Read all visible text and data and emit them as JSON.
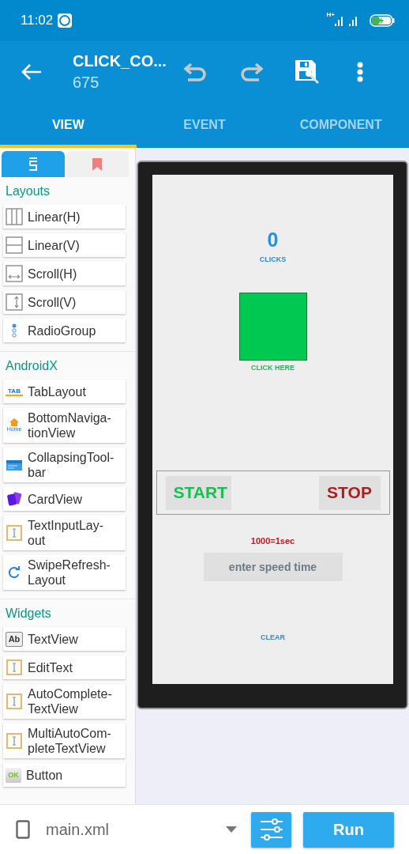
{
  "status_bar": {
    "time": "11:02",
    "network": "H+"
  },
  "app_bar": {
    "title": "CLICK_CO...",
    "subtitle": "675"
  },
  "tabs": [
    {
      "label": "VIEW",
      "selected": true
    },
    {
      "label": "EVENT",
      "selected": false
    },
    {
      "label": "COMPONENT",
      "selected": false
    }
  ],
  "palette": {
    "tabs": [
      {
        "kind": "widgets",
        "selected": true
      },
      {
        "kind": "bookmarks",
        "selected": false
      }
    ],
    "sections": [
      {
        "title": "Layouts",
        "items": [
          {
            "kind": "linear-h",
            "label": "Linear(H)"
          },
          {
            "kind": "linear-v",
            "label": "Linear(V)"
          },
          {
            "kind": "scroll-h",
            "label": "Scroll(H)"
          },
          {
            "kind": "scroll-v",
            "label": "Scroll(V)"
          },
          {
            "kind": "radio-group",
            "label": "RadioGroup"
          }
        ]
      },
      {
        "title": "AndroidX",
        "items": [
          {
            "kind": "tab-layout",
            "label": "TabLayout",
            "icon_text": "TAB"
          },
          {
            "kind": "bottom-nav",
            "label": "BottomNaviga-tionView",
            "icon_text": "Home"
          },
          {
            "kind": "collapsing-toolbar",
            "label": "CollapsingTool-bar"
          },
          {
            "kind": "card-view",
            "label": "CardView"
          },
          {
            "kind": "text-input",
            "label": "TextInputLay-out"
          },
          {
            "kind": "swipe-refresh",
            "label": "SwipeRefresh-Layout"
          }
        ]
      },
      {
        "title": "Widgets",
        "items": [
          {
            "kind": "text-view",
            "label": "TextView",
            "icon_text": "Ab"
          },
          {
            "kind": "edit-text",
            "label": "EditText"
          },
          {
            "kind": "edit-text",
            "label": "AutoComplete-TextView"
          },
          {
            "kind": "edit-text",
            "label": "MultiAutoCom-pleteTextView"
          },
          {
            "kind": "button",
            "label": "Button",
            "icon_text": "OK"
          }
        ]
      }
    ]
  },
  "preview": {
    "counter": "0",
    "counter_label": "CLICKS",
    "click_area_label": "CLICK HERE",
    "start": "START",
    "stop": "STOP",
    "speed_hint": "1000=1sec",
    "speed_placeholder": "enter speed time",
    "clear": "CLEAR"
  },
  "bottom_bar": {
    "file": "main.xml",
    "run": "Run"
  }
}
